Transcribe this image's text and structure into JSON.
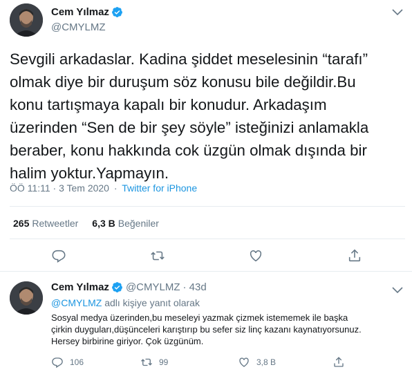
{
  "main_tweet": {
    "display_name": "Cem Yılmaz",
    "handle": "@CMYLMZ",
    "text": "Sevgili arkadaslar. Kadina şiddet meselesinin “tarafı”\nolmak diye bir duruşum söz konusu bile değildir.Bu\nkonu tartışmaya kapalı bir konudur. Arkadaşım\nüzerinden “Sen de bir şey söyle” isteğinizi anlamakla\nberaber, konu hakkında cok üzgün olmak dışında bir\nhalim yoktur.Yapmayın.",
    "timestamp": "ÖÖ 11:11 · 3 Tem 2020",
    "separator": "·",
    "source": "Twitter for iPhone",
    "retweets_count": "265",
    "retweets_label": "Retweetler",
    "likes_count": "6,3 B",
    "likes_label": "Beğeniler"
  },
  "reply_tweet": {
    "display_name": "Cem Yılmaz",
    "handle": "@CMYLMZ",
    "age": "· 43d",
    "reply_to_mention": "@CMYLMZ",
    "reply_to_suffix": "adlı kişiye yanıt olarak",
    "text": "Sosyal medya üzerinden,bu meseleyi yazmak çizmek istememek ile başka\nçirkin duyguları,düşünceleri karıştırıp bu sefer siz linç kazanı kaynatıyorsunuz.\nHersey birbirine giriyor. Çok üzgünüm.",
    "replies": "106",
    "retweets": "99",
    "likes": "3,8 B"
  },
  "colors": {
    "text": "#14171a",
    "secondary": "#657786",
    "link": "#1b95e0",
    "verified": "#1da1f2",
    "divider": "#e6ecf0"
  },
  "icons": {
    "verified": "verified-badge-icon",
    "caret": "chevron-down-icon",
    "reply": "reply-bubble-icon",
    "retweet": "retweet-icon",
    "like": "heart-icon",
    "share": "share-icon"
  }
}
